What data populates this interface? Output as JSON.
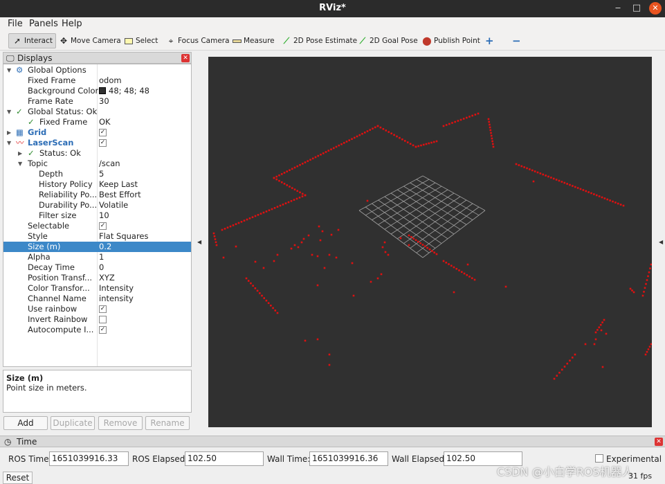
{
  "window": {
    "title": "RViz*",
    "minimize": "‒",
    "maximize": "□",
    "close": "✕"
  },
  "menu": {
    "file": "File",
    "panels": "Panels",
    "help": "Help"
  },
  "toolbar": {
    "interact": "Interact",
    "move_camera": "Move Camera",
    "select": "Select",
    "focus_camera": "Focus Camera",
    "measure": "Measure",
    "pose_estimate": "2D Pose Estimate",
    "goal_pose": "2D Goal Pose",
    "publish_point": "Publish Point",
    "plus": "+",
    "minus": "−"
  },
  "displays": {
    "title": "Displays",
    "rows": [
      {
        "name": "Global Options",
        "value": ""
      },
      {
        "name": "Fixed Frame",
        "value": "odom"
      },
      {
        "name": "Background Color",
        "value": "48; 48; 48"
      },
      {
        "name": "Frame Rate",
        "value": "30"
      },
      {
        "name": "Global Status: Ok",
        "value": ""
      },
      {
        "name": "Fixed Frame",
        "value": "OK"
      },
      {
        "name": "Grid",
        "value": ""
      },
      {
        "name": "LaserScan",
        "value": ""
      },
      {
        "name": "Status: Ok",
        "value": ""
      },
      {
        "name": "Topic",
        "value": "/scan"
      },
      {
        "name": "Depth",
        "value": "5"
      },
      {
        "name": "History Policy",
        "value": "Keep Last"
      },
      {
        "name": "Reliability Po...",
        "value": "Best Effort"
      },
      {
        "name": "Durability Po...",
        "value": "Volatile"
      },
      {
        "name": "Filter size",
        "value": "10"
      },
      {
        "name": "Selectable",
        "value": ""
      },
      {
        "name": "Style",
        "value": "Flat Squares"
      },
      {
        "name": "Size (m)",
        "value": "0.2"
      },
      {
        "name": "Alpha",
        "value": "1"
      },
      {
        "name": "Decay Time",
        "value": "0"
      },
      {
        "name": "Position Transf...",
        "value": "XYZ"
      },
      {
        "name": "Color Transfor...",
        "value": "Intensity"
      },
      {
        "name": "Channel Name",
        "value": "intensity"
      },
      {
        "name": "Use rainbow",
        "value": ""
      },
      {
        "name": "Invert Rainbow",
        "value": ""
      },
      {
        "name": "Autocompute I...",
        "value": ""
      }
    ],
    "checkboxes": {
      "grid": true,
      "laserscan": true,
      "selectable": true,
      "use_rainbow": true,
      "invert_rainbow": false,
      "autocompute": true
    },
    "selected_row": "Size (m)",
    "description_title": "Size (m)",
    "description_text": "Point size in meters.",
    "buttons": {
      "add": "Add",
      "duplicate": "Duplicate",
      "remove": "Remove",
      "rename": "Rename"
    }
  },
  "viewport": {
    "background": "#303030",
    "scan_color": "#e01010",
    "grid_color": "#a0a0a0"
  },
  "time": {
    "title": "Time",
    "ros_time_label": "ROS Time:",
    "ros_time": "1651039916.33",
    "ros_elapsed_label": "ROS Elapsed:",
    "ros_elapsed": "102.50",
    "wall_time_label": "Wall Time:",
    "wall_time": "1651039916.36",
    "wall_elapsed_label": "Wall Elapsed:",
    "wall_elapsed": "102.50",
    "experimental": "Experimental",
    "reset": "Reset",
    "fps": "31 fps"
  },
  "watermark": "CSDN @小白学ROS机器人"
}
